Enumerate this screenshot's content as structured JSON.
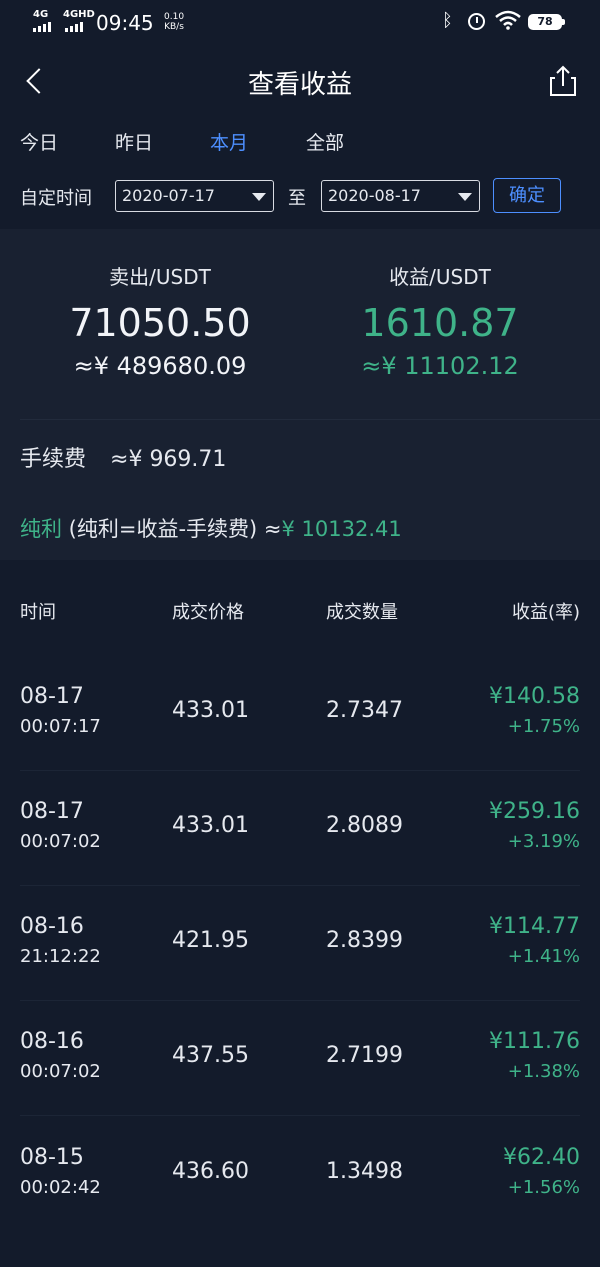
{
  "status_bar": {
    "net1": "4G",
    "net2": "4GHD",
    "time": "09:45",
    "speed_value": "0.10",
    "speed_unit": "KB/s",
    "battery": "78"
  },
  "header": {
    "title": "查看收益"
  },
  "tabs": [
    {
      "label": "今日",
      "active": false
    },
    {
      "label": "昨日",
      "active": false
    },
    {
      "label": "本月",
      "active": true
    },
    {
      "label": "全部",
      "active": false
    }
  ],
  "date_filter": {
    "label": "自定时间",
    "start": "2020-07-17",
    "separator": "至",
    "end": "2020-08-17",
    "confirm_label": "确定"
  },
  "summary": {
    "sell_label": "卖出/USDT",
    "sell_value": "71050.50",
    "sell_cny": "≈¥ 489680.09",
    "profit_label": "收益/USDT",
    "profit_value": "1610.87",
    "profit_cny": "≈¥ 11102.12",
    "fee_label": "手续费",
    "fee_value": "≈¥ 969.71",
    "net_label": "纯利",
    "net_formula": " (纯利=收益-手续费) ≈",
    "net_value": "¥ 10132.41"
  },
  "table": {
    "headers": {
      "time": "时间",
      "price": "成交价格",
      "qty": "成交数量",
      "profit": "收益(率)"
    },
    "rows": [
      {
        "date": "08-17",
        "time": "00:07:17",
        "price": "433.01",
        "qty": "2.7347",
        "amount": "¥140.58",
        "rate": "+1.75%"
      },
      {
        "date": "08-17",
        "time": "00:07:02",
        "price": "433.01",
        "qty": "2.8089",
        "amount": "¥259.16",
        "rate": "+3.19%"
      },
      {
        "date": "08-16",
        "time": "21:12:22",
        "price": "421.95",
        "qty": "2.8399",
        "amount": "¥114.77",
        "rate": "+1.41%"
      },
      {
        "date": "08-16",
        "time": "00:07:02",
        "price": "437.55",
        "qty": "2.7199",
        "amount": "¥111.76",
        "rate": "+1.38%"
      },
      {
        "date": "08-15",
        "time": "00:02:42",
        "price": "436.60",
        "qty": "1.3498",
        "amount": "¥62.40",
        "rate": "+1.56%"
      }
    ]
  }
}
